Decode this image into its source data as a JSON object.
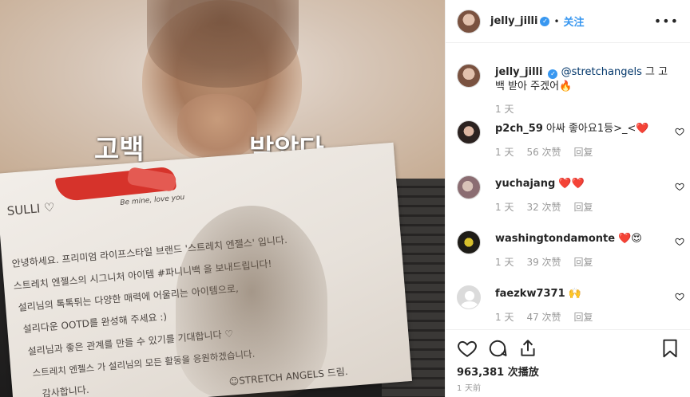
{
  "media": {
    "caption_left": "고백",
    "caption_right": "받았다",
    "note_lines": [
      "SULLI ♡",
      "Be mine, love you",
      "안녕하세요. 프리미엄 라이프스타일 브랜드 '스트레치 엔젤스' 입니다.",
      "스트레치 엔젤스의 시그니처 아이템 #파니니백 을 보내드립니다!",
      "설리님의 톡톡튀는 다양한 매력에 어울리는 아이템으로,",
      "설리다운 OOTD를 완성해 주세요 :)",
      "설리님과 좋은 관계를 만들 수 있기를 기대합니다 ♡",
      "스트레치 엔젤스 가 설리님의 모든 활동을 응원하겠습니다.",
      "감사합니다.",
      "☺STRETCH ANGELS 드림."
    ]
  },
  "header": {
    "username": "jelly_jilli",
    "dot": "•",
    "follow_label": "关注",
    "more_label": "•••"
  },
  "caption": {
    "username": "jelly_jilli",
    "mention": "@stretchangels",
    "text": " 그 고백 받아 주겠어🔥",
    "time": "1 天"
  },
  "comments": [
    {
      "username": "p2ch_59",
      "text": "아싸 좋아요1등>_<❤️",
      "time": "1 天",
      "likes": "56 次赞",
      "reply": "回复"
    },
    {
      "username": "yuchajang",
      "text": "❤️❤️",
      "time": "1 天",
      "likes": "32 次赞",
      "reply": "回复"
    },
    {
      "username": "washingtondamonte",
      "text": "❤️😍",
      "time": "1 天",
      "likes": "39 次赞",
      "reply": "回复"
    },
    {
      "username": "faezkw7371",
      "text": "🙌",
      "time": "1 天",
      "likes": "47 次赞",
      "reply": "回复"
    }
  ],
  "footer": {
    "views": "963,381 次播放",
    "posted": "1 天前"
  },
  "icons": {
    "like": "heart-icon",
    "comment": "comment-icon",
    "share": "share-icon",
    "save": "bookmark-icon"
  }
}
